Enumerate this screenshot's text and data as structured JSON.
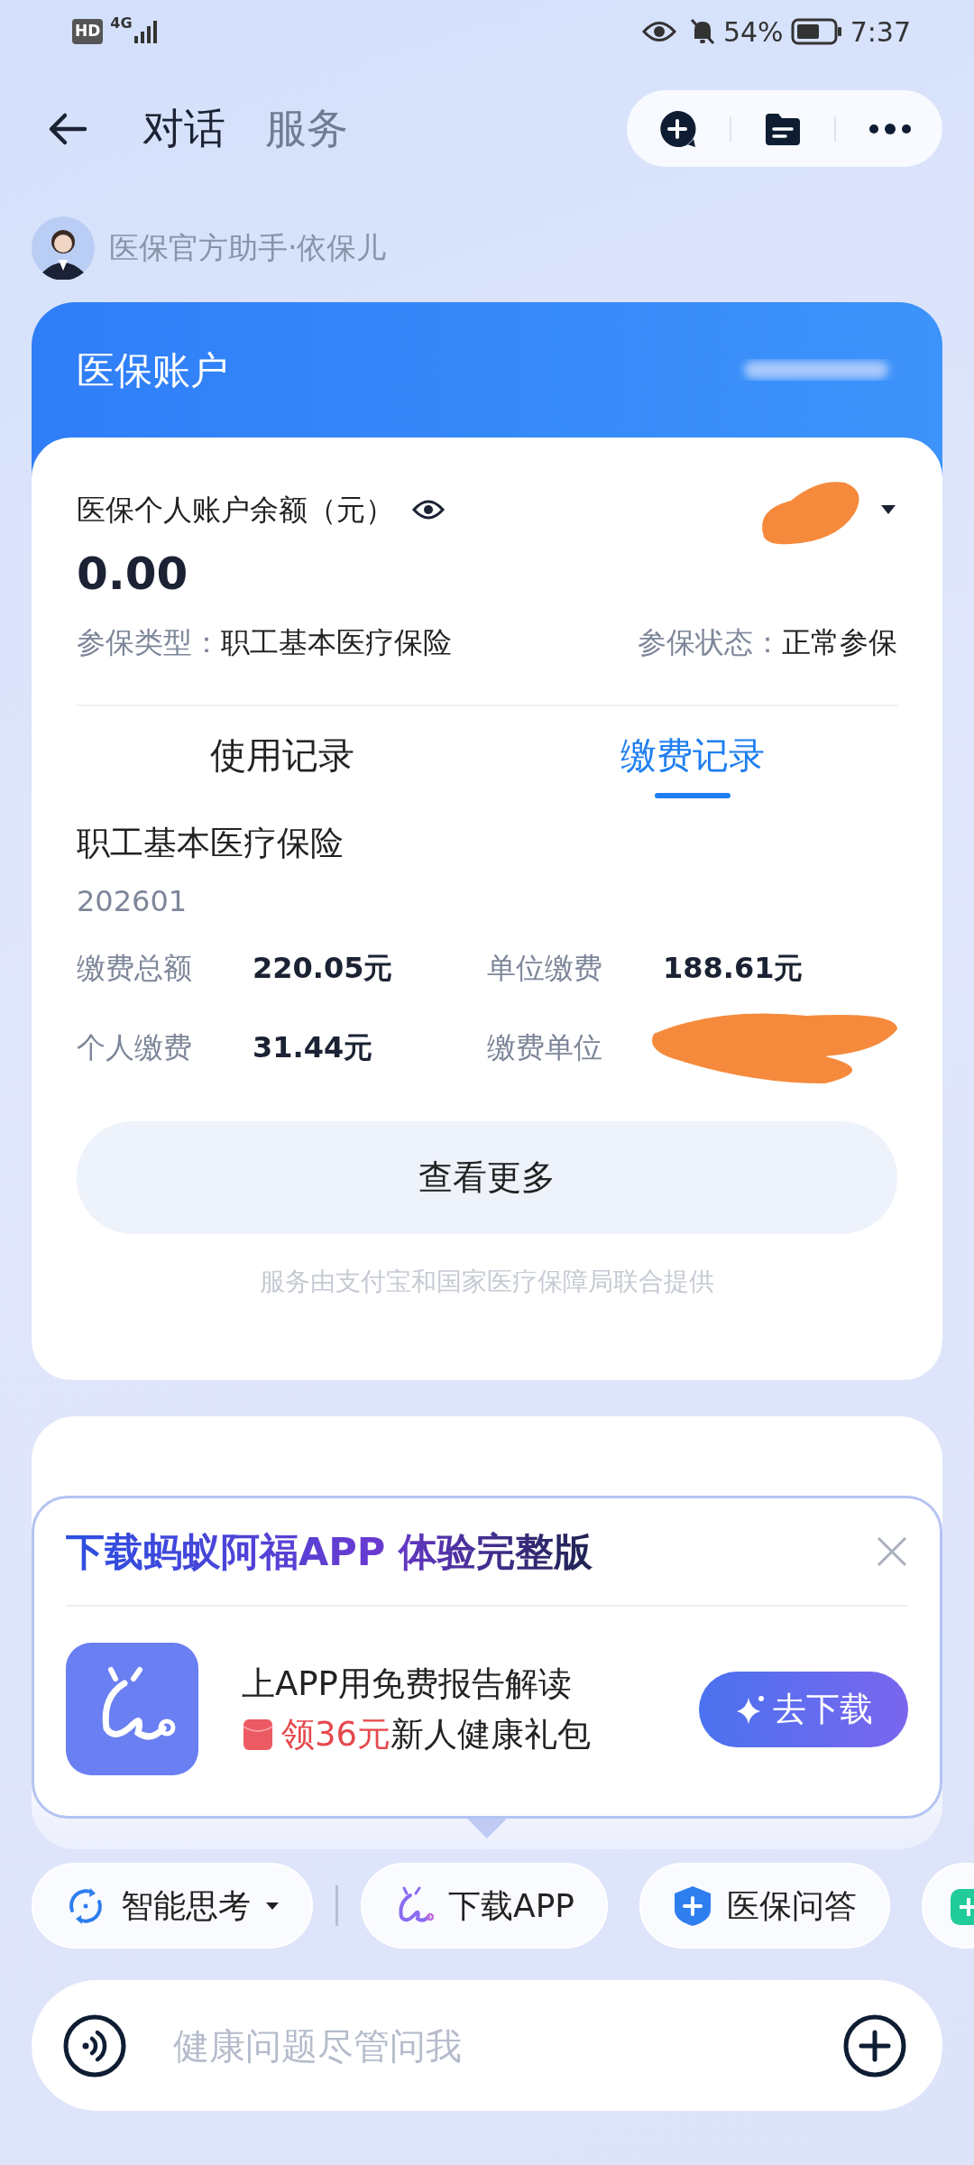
{
  "status_bar": {
    "hd": "HD",
    "network": "4G",
    "battery": "54%",
    "time": "7:37"
  },
  "nav": {
    "tabs": [
      {
        "label": "对话",
        "selected": true
      },
      {
        "label": "服务",
        "selected": false
      }
    ]
  },
  "assistant": {
    "name": "医保官方助手·依保儿"
  },
  "account_card": {
    "title": "医保账户",
    "balance_label": "医保个人账户余额（元）",
    "balance": "0.00",
    "type_label": "参保类型：",
    "type_value": "职工基本医疗保险",
    "status_label": "参保状态：",
    "status_value": "正常参保",
    "tabs": [
      {
        "label": "使用记录",
        "selected": false
      },
      {
        "label": "缴费记录",
        "selected": true
      }
    ],
    "record": {
      "title": "职工基本医疗保险",
      "period": "202601",
      "fields": [
        {
          "label": "缴费总额",
          "value": "220.05元",
          "redacted": false
        },
        {
          "label": "单位缴费",
          "value": "188.61元",
          "redacted": false
        },
        {
          "label": "个人缴费",
          "value": "31.44元",
          "redacted": false
        },
        {
          "label": "缴费单位",
          "redacted": true
        }
      ]
    },
    "more_button": "查看更多",
    "footer": "服务由支付宝和国家医疗保障局联合提供"
  },
  "popup": {
    "title": "下载蚂蚁阿福APP 体验完整版",
    "line1": "上APP用免费报告解读",
    "promo_amount": "领36元",
    "promo_text": "新人健康礼包",
    "button": "去下载"
  },
  "chips": [
    {
      "label": "智能思考",
      "kind": "dropdown"
    },
    {
      "label": "下载APP",
      "kind": "app"
    },
    {
      "label": "医保问答",
      "kind": "qa"
    },
    {
      "kind": "partial"
    }
  ],
  "input": {
    "placeholder": "健康问题尽管问我"
  }
}
